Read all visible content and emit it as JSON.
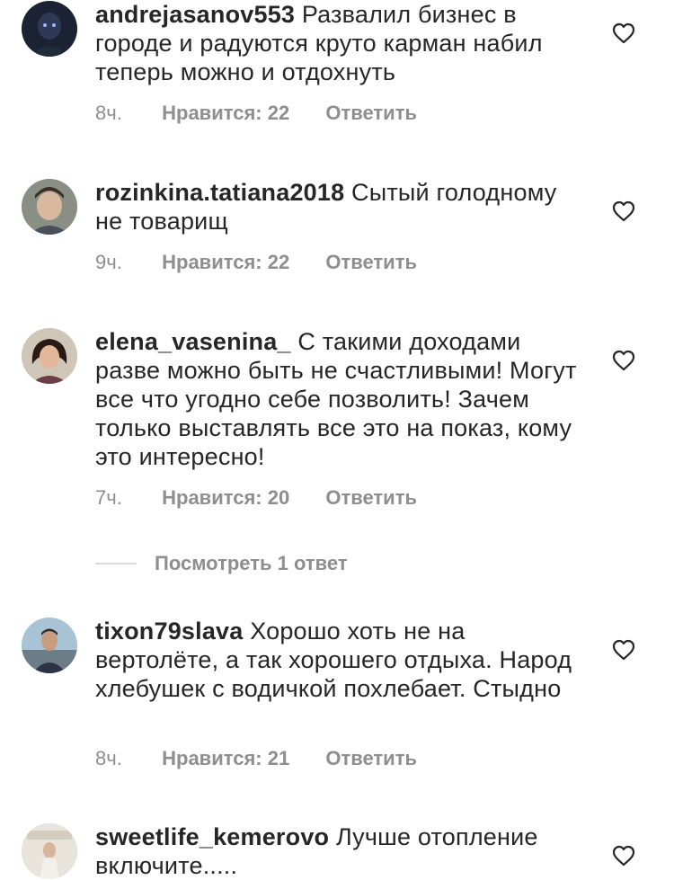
{
  "comments": [
    {
      "username": "andrejasanov553",
      "text": "Развалил бизнес в городе и радуются круто карман набил теперь можно и отдохнуть",
      "time": "8ч.",
      "likes": "Нравится: 22",
      "reply": "Ответить"
    },
    {
      "username": "rozinkina.tatiana2018",
      "text": "Сытый голодному не товарищ",
      "time": "9ч.",
      "likes": "Нравится: 22",
      "reply": "Ответить"
    },
    {
      "username": "elena_vasenina_",
      "text": "С такими доходами разве можно быть не счастливыми! Могут все что угодно себе позволить! Зачем только выставлять все это на показ, кому это интересно!",
      "time": "7ч.",
      "likes": "Нравится: 20",
      "reply": "Ответить",
      "view_replies": "Посмотреть 1 ответ"
    },
    {
      "username": "tixon79slava",
      "text": "Хорошо хоть не на вертолёте, а так хорошего отдыха. Народ хлебушек с водичкой похлебает. Стыдно",
      "time": "8ч.",
      "likes": "Нравится: 21",
      "reply": "Ответить"
    },
    {
      "username": "sweetlife_kemerovo",
      "text": "Лучше отопление включите.....",
      "time": "",
      "likes": "",
      "reply": ""
    }
  ],
  "icons": {
    "heart": "heart-outline-icon"
  },
  "colors": {
    "text": "#262626",
    "meta": "#8e8e8e",
    "divider": "#dbdbdb"
  }
}
